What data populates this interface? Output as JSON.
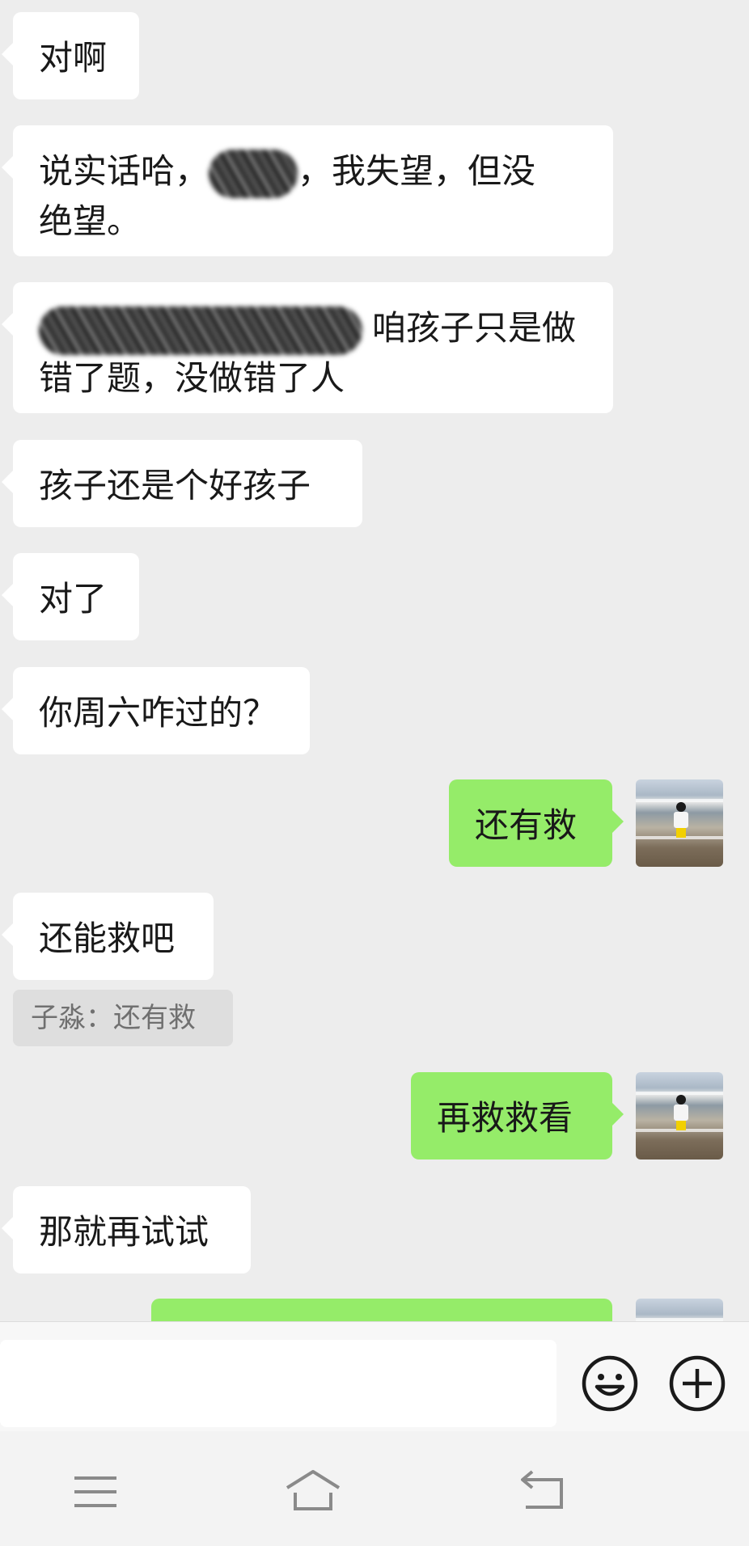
{
  "messages": [
    {
      "side": "in",
      "text": "对啊"
    },
    {
      "side": "in",
      "line1_a": "说实话哈，",
      "line1_b": "，我失望，但没",
      "line2": "绝望。"
    },
    {
      "side": "in",
      "line1": "咱孩子只是做",
      "line2": "错了题，没做错了人"
    },
    {
      "side": "in",
      "text": "孩子还是个好孩子"
    },
    {
      "side": "in",
      "text": "对了"
    },
    {
      "side": "in",
      "text": "你周六咋过的？"
    },
    {
      "side": "out",
      "text": "还有救"
    },
    {
      "side": "in",
      "text": "还能救吧",
      "quote": "子淼：还有救"
    },
    {
      "side": "out",
      "text": "再救救看"
    },
    {
      "side": "in",
      "text": "那就再试试"
    }
  ],
  "input": {
    "value": "",
    "emoji_icon": "smiley-icon",
    "more_icon": "plus-circle-icon"
  },
  "navbar": {
    "menu_icon": "menu-icon",
    "home_icon": "home-icon",
    "back_icon": "back-icon"
  },
  "colors": {
    "background": "#ededed",
    "incoming": "#ffffff",
    "outgoing": "#95ec69",
    "text": "#191919"
  }
}
